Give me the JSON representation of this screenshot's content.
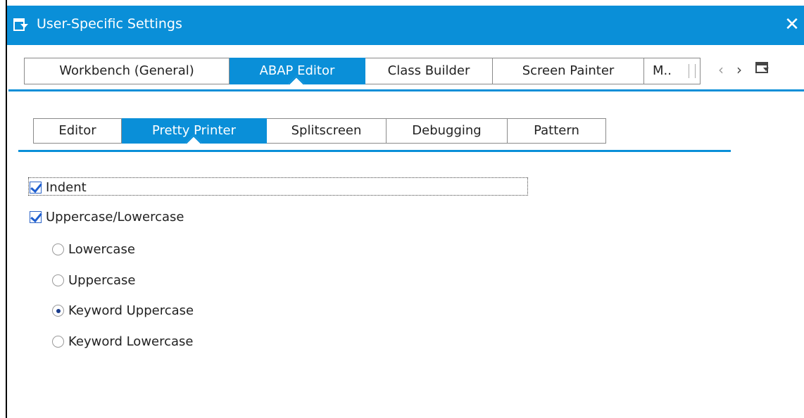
{
  "window": {
    "title": "User-Specific Settings",
    "close_glyph": "✕",
    "accent_color": "#0a8fd8"
  },
  "outer_tabs": [
    {
      "label": "Workbench (General)",
      "active": false
    },
    {
      "label": "ABAP Editor",
      "active": true
    },
    {
      "label": "Class Builder",
      "active": false
    },
    {
      "label": "Screen Painter",
      "active": false
    },
    {
      "label": "M..",
      "active": false
    }
  ],
  "nav": {
    "prev_glyph": "‹",
    "next_glyph": "›",
    "list_icon": "tab-list-icon"
  },
  "inner_tabs": [
    {
      "label": "Editor",
      "active": false
    },
    {
      "label": "Pretty Printer",
      "active": true
    },
    {
      "label": "Splitscreen",
      "active": false
    },
    {
      "label": "Debugging",
      "active": false
    },
    {
      "label": "Pattern",
      "active": false
    }
  ],
  "options": {
    "indent": {
      "label": "Indent",
      "checked": true
    },
    "case": {
      "label": "Uppercase/Lowercase",
      "checked": true
    },
    "radios": [
      {
        "label": "Lowercase",
        "selected": false
      },
      {
        "label": "Uppercase",
        "selected": false
      },
      {
        "label": "Keyword Uppercase",
        "selected": true
      },
      {
        "label": "Keyword Lowercase",
        "selected": false
      }
    ]
  }
}
